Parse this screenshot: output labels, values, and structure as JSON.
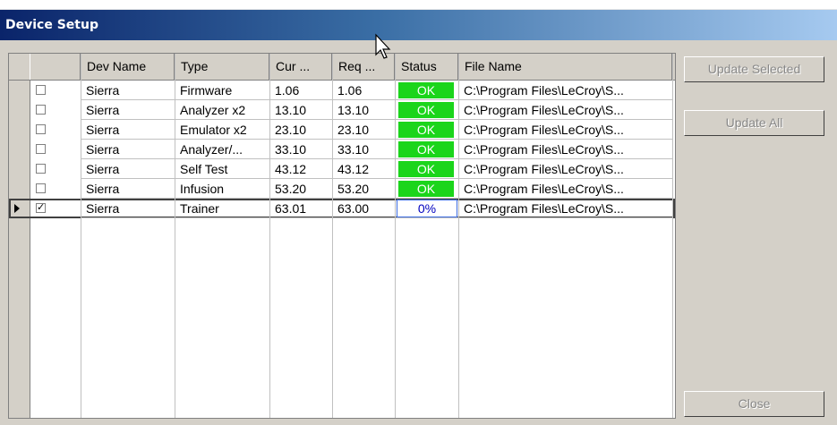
{
  "window": {
    "title": "Device Setup"
  },
  "table": {
    "headers": [
      "Dev Name",
      "Type",
      "Cur ...",
      "Req ...",
      "Status",
      "File Name"
    ],
    "rows": [
      {
        "checked": false,
        "dev_name": "Sierra",
        "type": "Firmware",
        "cur": "1.06",
        "req": "1.06",
        "status": "OK",
        "file": "C:\\Program Files\\LeCroy\\S..."
      },
      {
        "checked": false,
        "dev_name": "Sierra",
        "type": "Analyzer x2",
        "cur": "13.10",
        "req": "13.10",
        "status": "OK",
        "file": "C:\\Program Files\\LeCroy\\S..."
      },
      {
        "checked": false,
        "dev_name": "Sierra",
        "type": "Emulator x2",
        "cur": "23.10",
        "req": "23.10",
        "status": "OK",
        "file": "C:\\Program Files\\LeCroy\\S..."
      },
      {
        "checked": false,
        "dev_name": "Sierra",
        "type": "Analyzer/...",
        "cur": "33.10",
        "req": "33.10",
        "status": "OK",
        "file": "C:\\Program Files\\LeCroy\\S..."
      },
      {
        "checked": false,
        "dev_name": "Sierra",
        "type": "Self Test",
        "cur": "43.12",
        "req": "43.12",
        "status": "OK",
        "file": "C:\\Program Files\\LeCroy\\S..."
      },
      {
        "checked": false,
        "dev_name": "Sierra",
        "type": "Infusion",
        "cur": "53.20",
        "req": "53.20",
        "status": "OK",
        "file": "C:\\Program Files\\LeCroy\\S..."
      },
      {
        "checked": true,
        "dev_name": "Sierra",
        "type": "Trainer",
        "cur": "63.01",
        "req": "63.00",
        "status": "0%",
        "file": "C:\\Program Files\\LeCroy\\S...",
        "selected": true
      }
    ]
  },
  "buttons": {
    "update_selected": "Update Selected",
    "update_all": "Update All",
    "close": "Close"
  },
  "colors": {
    "status_ok": "#1bd51b",
    "title_start": "#0a246a",
    "title_end": "#a6caf0"
  }
}
